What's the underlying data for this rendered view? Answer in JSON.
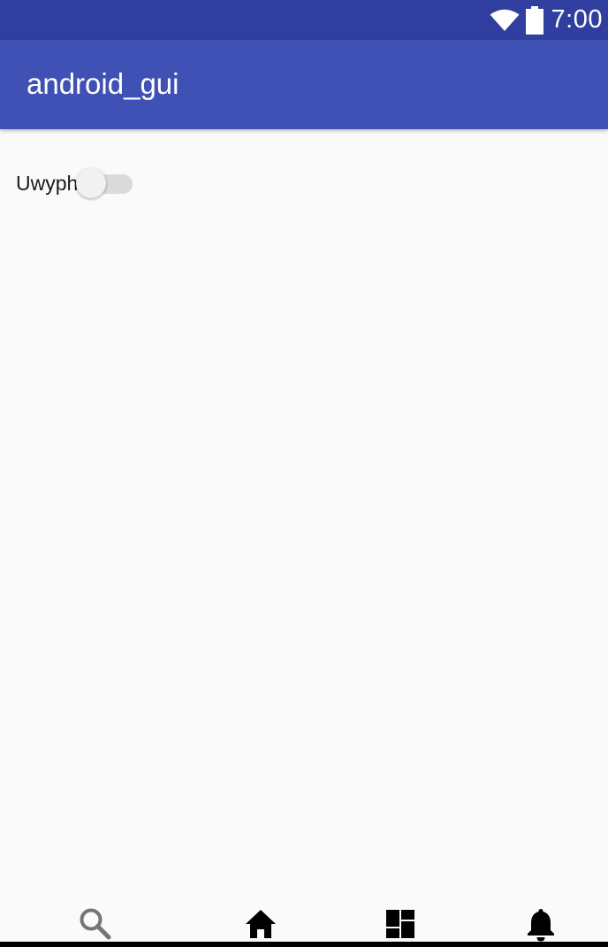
{
  "status_bar": {
    "time": "7:00",
    "icons": [
      "wifi-icon",
      "battery-icon"
    ]
  },
  "app_bar": {
    "title": "android_gui"
  },
  "content": {
    "switch": {
      "label": "Uwyph",
      "checked": false
    }
  },
  "bottom_nav": {
    "items": [
      {
        "icon": "search-icon",
        "selected": false
      },
      {
        "icon": "home-icon",
        "selected": true
      },
      {
        "icon": "dashboard-icon",
        "selected": true
      },
      {
        "icon": "notifications-icon",
        "selected": true
      }
    ]
  },
  "colors": {
    "status_bar": "#303f9f",
    "app_bar": "#3f51b5",
    "background": "#fafafa"
  }
}
